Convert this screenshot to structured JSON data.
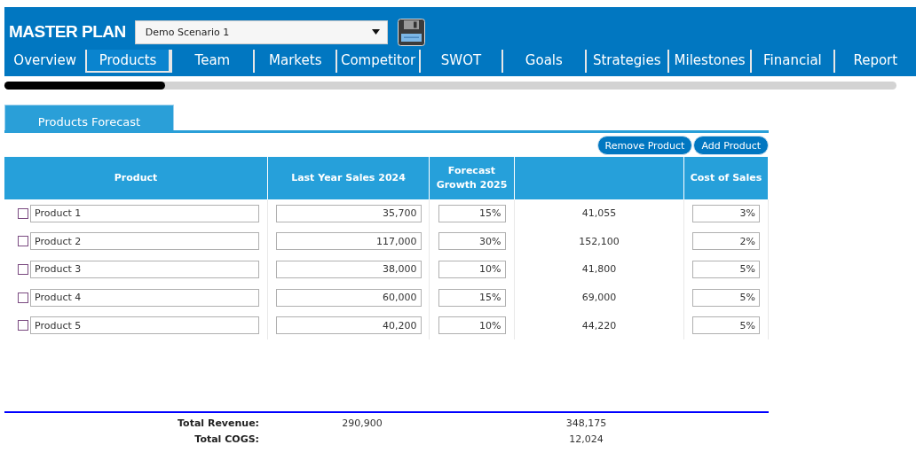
{
  "app": {
    "title": "MASTER PLAN",
    "scenario": "Demo Scenario 1"
  },
  "tabs": [
    {
      "label": "Overview",
      "selected": false
    },
    {
      "label": "Products",
      "selected": true
    },
    {
      "label": "Team",
      "selected": false
    },
    {
      "label": "Markets",
      "selected": false
    },
    {
      "label": "Competitor",
      "selected": false
    },
    {
      "label": "SWOT",
      "selected": false
    },
    {
      "label": "Goals",
      "selected": false
    },
    {
      "label": "Strategies",
      "selected": false
    },
    {
      "label": "Milestones",
      "selected": false
    },
    {
      "label": "Financial",
      "selected": false
    },
    {
      "label": "Report",
      "selected": false
    }
  ],
  "progress": {
    "level": 0.18
  },
  "section": {
    "title": "Products Forecast"
  },
  "buttons": [
    "Remove Product",
    "Add Product"
  ],
  "table": {
    "columns": [
      "Product",
      "Last Year Sales 2024",
      "Forecast Growth 2025",
      "Cost of Sales"
    ],
    "rows": [
      {
        "checked": false,
        "product": "Product 1",
        "last_year_sales": "35,700",
        "growth": "15%",
        "column_4": "41,055",
        "cost_of_sales": "3%"
      },
      {
        "checked": false,
        "product": "Product 2",
        "last_year_sales": "117,000",
        "growth": "30%",
        "column_4": "152,100",
        "cost_of_sales": "2%"
      },
      {
        "checked": false,
        "product": "Product 3",
        "last_year_sales": "38,000",
        "growth": "10%",
        "column_4": "41,800",
        "cost_of_sales": "5%"
      },
      {
        "checked": false,
        "product": "Product 4",
        "last_year_sales": "60,000",
        "growth": "15%",
        "column_4": "69,000",
        "cost_of_sales": "5%"
      },
      {
        "checked": false,
        "product": "Product 5",
        "last_year_sales": "40,200",
        "growth": "10%",
        "column_4": "44,220",
        "cost_of_sales": "5%"
      }
    ]
  },
  "totals": [
    {
      "label": "Total Revenue:",
      "last_year_sales": "290,900",
      "column_4": "348,175"
    },
    {
      "label": "Total COGS:",
      "column_4": "12,024"
    }
  ]
}
